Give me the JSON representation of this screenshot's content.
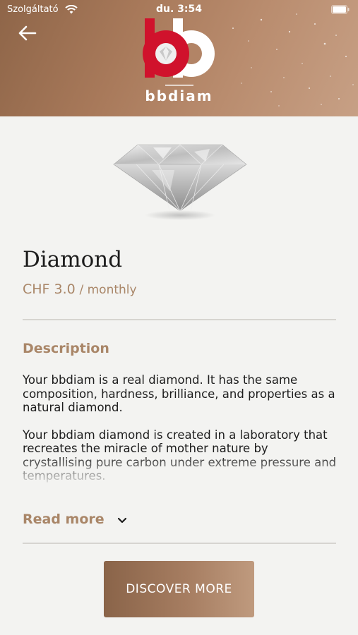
{
  "status_bar": {
    "carrier": "Szolgáltató",
    "time": "du. 3:54"
  },
  "header": {
    "logo_text": "bbdiam",
    "back_icon": "arrow-left-icon"
  },
  "product": {
    "name": "Diamond",
    "price": "CHF 3.0",
    "period": "/ monthly"
  },
  "description": {
    "heading": "Description",
    "paragraphs": [
      "Your bbdiam is a real diamond. It has the same composition, hardness, brilliance, and properties as a natural diamond.",
      "Your bbdiam diamond is created in a laboratory that recreates the miracle of mother nature by crystallising pure carbon under extreme pressure and temperatures."
    ],
    "read_more": "Read more"
  },
  "cta": {
    "label": "DISCOVER MORE"
  },
  "colors": {
    "accent": "#a98668",
    "header_bg": "#a8795a",
    "logo_red": "#d0122c",
    "background": "#f3f3f1"
  }
}
